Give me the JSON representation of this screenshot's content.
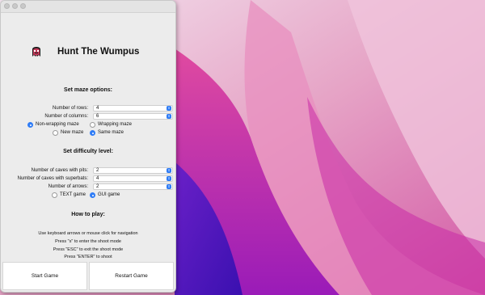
{
  "window": {
    "title": "Hunt The Wumpus"
  },
  "maze": {
    "heading": "Set maze options:",
    "rows_label": "Number of rows:",
    "rows_value": "4",
    "cols_label": "Number of columns:",
    "cols_value": "6",
    "non_wrapping": "Non-wrapping maze",
    "wrapping": "Wrapping maze",
    "new_maze": "New maze",
    "same_maze": "Same maze"
  },
  "difficulty": {
    "heading": "Set difficulty level:",
    "pits_label": "Number of caves with pits:",
    "pits_value": "2",
    "superbats_label": "Number of caves with superbats:",
    "superbats_value": "4",
    "arrows_label": "Number of arrows:",
    "arrows_value": "2",
    "text_game": "TEXT game",
    "gui_game": "GUI game"
  },
  "howto": {
    "heading": "How to play:",
    "line1": "Use keyboard arrows or mouse click for navigation",
    "line2": "Press \"s\" to enter the shoot mode",
    "line3": "Press \"ESC\" to exit the shoot mode",
    "line4": "Press \"ENTER\" to shoot"
  },
  "buttons": {
    "start": "Start Game",
    "restart": "Restart Game"
  },
  "colors": {
    "accent": "#2f7cf6",
    "desktop_magenta": "#b21aa8",
    "desktop_pink": "#e07bb0"
  },
  "icons": {
    "logo": "wumpus-monster-icon",
    "stepper": "up-down-stepper-icon"
  }
}
